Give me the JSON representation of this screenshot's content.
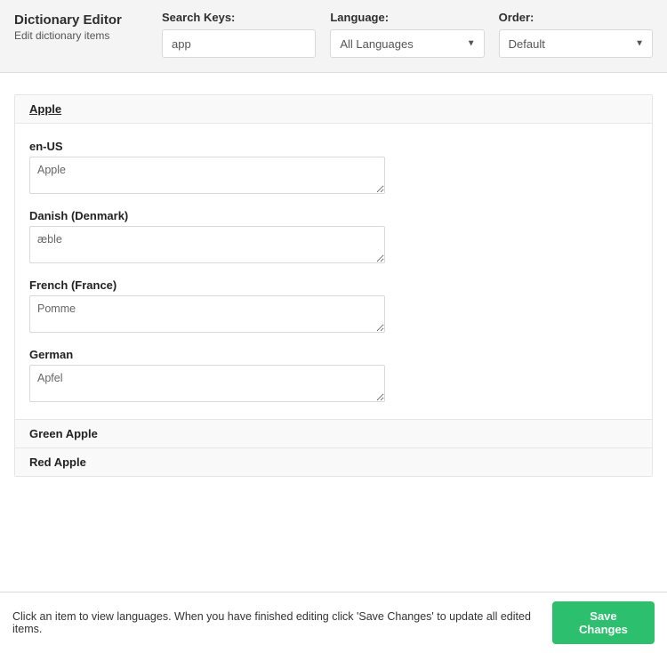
{
  "header": {
    "title": "Dictionary Editor",
    "subtitle": "Edit dictionary items",
    "search": {
      "label": "Search Keys:",
      "value": "app"
    },
    "language": {
      "label": "Language:",
      "selected": "All Languages"
    },
    "order": {
      "label": "Order:",
      "selected": "Default"
    }
  },
  "items": [
    {
      "key": "Apple",
      "expanded": true,
      "translations": [
        {
          "lang": "en-US",
          "value": "Apple"
        },
        {
          "lang": "Danish (Denmark)",
          "value": "æble"
        },
        {
          "lang": "French (France)",
          "value": "Pomme"
        },
        {
          "lang": "German",
          "value": "Apfel"
        }
      ]
    },
    {
      "key": "Green Apple",
      "expanded": false
    },
    {
      "key": "Red Apple",
      "expanded": false
    }
  ],
  "footer": {
    "hint": "Click an item to view languages. When you have finished editing click 'Save Changes' to update all edited items.",
    "save_label": "Save Changes"
  }
}
